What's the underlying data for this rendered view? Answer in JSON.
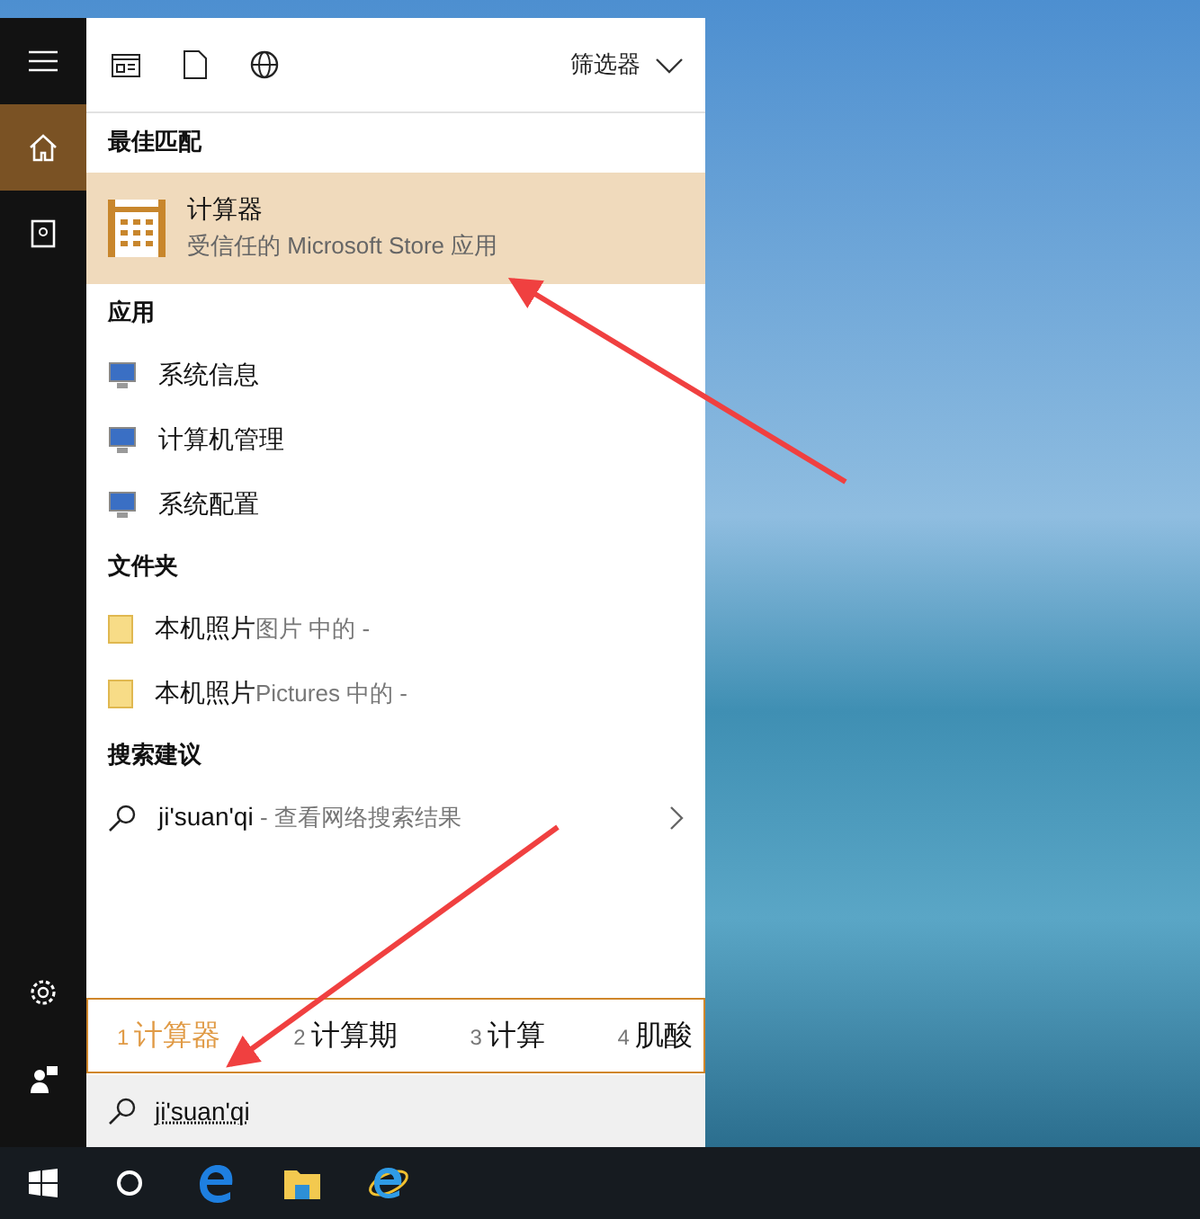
{
  "rail": {
    "top": [
      {
        "kind": "menu",
        "selected": false
      },
      {
        "kind": "home",
        "selected": true
      },
      {
        "kind": "notebook",
        "selected": false
      }
    ],
    "bottom": [
      {
        "kind": "settings",
        "selected": false
      },
      {
        "kind": "user",
        "selected": false
      }
    ]
  },
  "toolbar": {
    "filter": "筛选器"
  },
  "sections": [
    {
      "kind": "best",
      "title": "最佳匹配",
      "items": [
        {
          "name": "计算器",
          "detail": "受信任的 Microsoft Store 应用",
          "selected": true
        }
      ]
    },
    {
      "kind": "app",
      "title": "应用",
      "items": [
        {
          "name": "系统信息",
          "selected": false
        },
        {
          "name": "计算机管理",
          "selected": false
        },
        {
          "name": "系统配置",
          "selected": false
        }
      ]
    },
    {
      "kind": "folder",
      "title": "文件夹",
      "items": [
        {
          "name": "本机照片",
          "detail": "图片 中的 -",
          "selected": false
        },
        {
          "name": "本机照片",
          "detail": "Pictures 中的 -",
          "selected": false
        }
      ]
    },
    {
      "kind": "suggestion",
      "title": "搜索建议",
      "items": [
        {
          "name": "ji'suan'qi",
          "detail": " - 查看网络搜索结果",
          "selected": false
        }
      ]
    }
  ],
  "candidates": [
    {
      "number": "1",
      "text": "计算器",
      "selected": true
    },
    {
      "number": "2",
      "text": "计算期",
      "selected": false
    },
    {
      "number": "3",
      "text": "计算",
      "selected": false
    },
    {
      "number": "4",
      "text": "肌酸",
      "selected": false
    }
  ],
  "search": {
    "value": "ji'suan'qi"
  }
}
